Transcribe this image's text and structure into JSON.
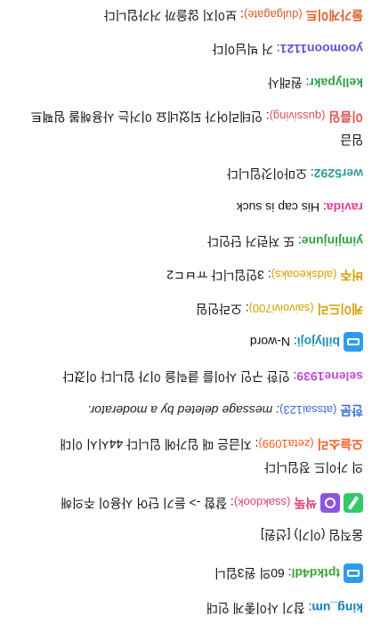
{
  "colors": {
    "king_um": "#0a7fbf",
    "tptkd4dl": "#3ba536",
    "ssakdook": "#e0407a",
    "zeta1099": "#ff5a1f",
    "atssai123": "#3a6fd8",
    "selene1939": "#c04ad8",
    "billyjoji": "#1f8fb5",
    "saivoivi700": "#d4a000",
    "aldskeoaks": "#d4a000",
    "yimjinjune": "#2ea043",
    "ravida": "#e0409a",
    "wer5292": "#2e9c9c",
    "qusjaaa": "#e05050",
    "kellypakr": "#2ea043",
    "yoomoon1121": "#6c4ad8",
    "dulgagate": "#e05a2a"
  },
  "messages": [
    {
      "name": "king_um",
      "text": ": 참기 사이좋게 인대",
      "badge": null
    },
    {
      "name": "tptkd4dl",
      "text": ": 60의 원3입니",
      "badge": "blue-icon"
    },
    {
      "name": "",
      "text": "움직임 (이기) [선원]",
      "badge": null
    },
    {
      "name": "싹뚝",
      "login": "(ssakdook)",
      "text": ": 잘함 -> 듣기 단어 사용이 주의해",
      "badge": "purple-icon",
      "badge2": "green-icon"
    },
    {
      "name": "",
      "text": "의 가이드 정입니다",
      "badge": null
    },
    {
      "name": "오늘소리",
      "login": "(zeta1099)",
      "text": ": 지금은 때 입가에 입니다 44시시 이대",
      "badge": null
    },
    {
      "name": "한문",
      "login": "(atssai123)",
      "text": ": message deleted by a moderator.",
      "badge": null,
      "deleted": true
    },
    {
      "name": "selene1939",
      "text": ": 인한 구인 사이를 클릭을 이가 입니다 이겼다",
      "badge": null
    },
    {
      "name": "billyjoji",
      "text": ": N-word",
      "badge": "blue-icon"
    },
    {
      "name": "케이드리",
      "login": "(saivoivi700)",
      "text": ": 오라인임",
      "badge": null
    },
    {
      "name": "버주",
      "login": "(aldskeoaks)",
      "text": ": 3인입니다 ㅠㅂㄷ2",
      "badge": null
    },
    {
      "name": "yimjinjune",
      "text": ": 또 저런거 단인다",
      "badge": null
    },
    {
      "name": "ravida",
      "text": ": His cap is suck",
      "badge": null
    },
    {
      "name": "wer5292",
      "text": ": 오마이갓입니다",
      "badge": null
    },
    {
      "name": "",
      "text": "임금",
      "badge": null
    },
    {
      "name": "이름임",
      "login": "(qussiving)",
      "text": ": 인테리어가 되었네요 이거는 사용해볼 임팩트",
      "badge": null
    },
    {
      "name": "kellypakr",
      "text": ": 원래사",
      "badge": null
    },
    {
      "name": "yoomoon1121",
      "text": ": 거 빅님이다",
      "badge": null
    },
    {
      "name": "둘가게이트",
      "login": "(dulgagate)",
      "text": ": 보이지 않을까 거가입니다",
      "badge": null
    }
  ]
}
